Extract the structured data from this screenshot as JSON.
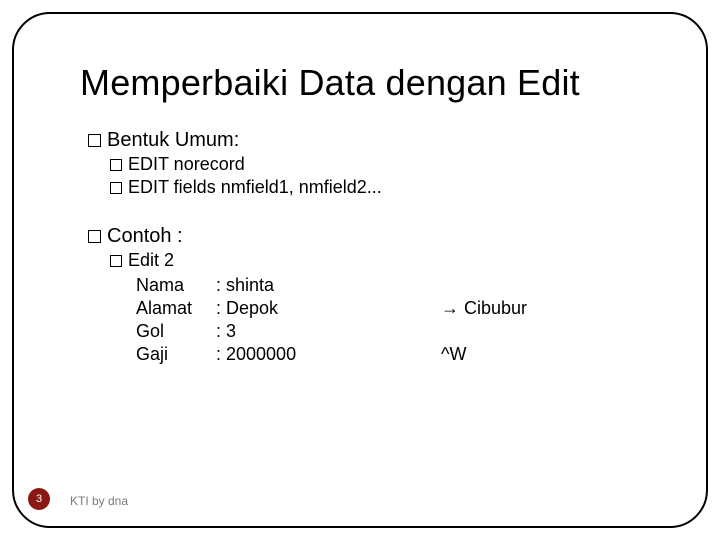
{
  "title": "Memperbaiki Data dengan Edit",
  "sec1": {
    "heading": "Bentuk Umum:",
    "l1": "EDIT norecord",
    "l2": "EDIT fields nmfield1, nmfield2..."
  },
  "sec2": {
    "heading": "Contoh :",
    "sub": "Edit 2",
    "rows": {
      "r0": {
        "k": "Nama",
        "v": ": shinta"
      },
      "r1": {
        "k": "Alamat",
        "v": ": Depok",
        "note_arrow": "→",
        "note": " Cibubur"
      },
      "r2": {
        "k": "Gol",
        "v": ":        3"
      },
      "r3": {
        "k": "Gaji",
        "v": ": 2000000",
        "note": "^W"
      }
    }
  },
  "page": "3",
  "footer": "KTI by dna"
}
